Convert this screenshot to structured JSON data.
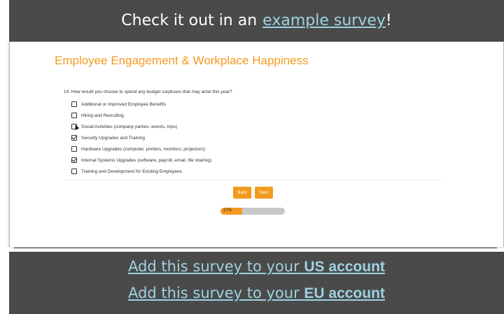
{
  "top_banner": {
    "text": "Check it out in an",
    "link": "example survey",
    "suffix": "!"
  },
  "survey": {
    "title": "Employee Engagement & Workplace Happiness",
    "question": "14. How would you choose to spend any budget surpluses that may arise this year?",
    "options": [
      {
        "label": "Additional or Improved Employee Benefits",
        "checked": false
      },
      {
        "label": "Hiring and Recruiting",
        "checked": false
      },
      {
        "label": "Social Activities (company parties, events, trips)",
        "checked": false
      },
      {
        "label": "Security Upgrades and Training",
        "checked": true
      },
      {
        "label": "Hardware Upgrades (computer, printers, monitors, projectors)",
        "checked": false
      },
      {
        "label": "Internal Systems Upgrades (software, payroll, email, file sharing)",
        "checked": true
      },
      {
        "label": "Training and Development for Existing Employees",
        "checked": false
      }
    ],
    "back_label": "Back",
    "next_label": "Next",
    "progress_text": "17%",
    "progress_value": 0.17
  },
  "bottom_banner": {
    "us_prefix": "Add this survey to your",
    "us_bold": "US account",
    "eu_prefix": "Add this survey to your",
    "eu_bold": "EU account"
  },
  "colors": {
    "accent": "#f39a1e",
    "banner": "#4a4a4a",
    "link": "#9dd3e3"
  }
}
